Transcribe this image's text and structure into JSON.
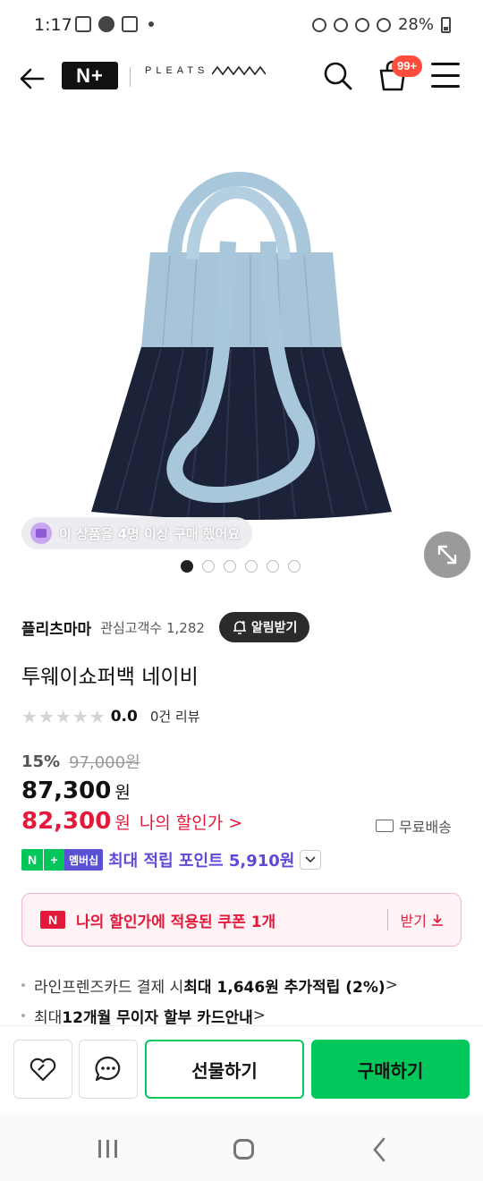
{
  "status_bar": {
    "time": "1:17",
    "battery": "28%"
  },
  "header": {
    "back_icon": "arrow-left-icon",
    "platform_logo": "N+",
    "brand_logo": "PLEATS",
    "search_icon": "search-icon",
    "cart_icon": "shopping-bag-icon",
    "cart_badge": "99+",
    "menu_icon": "hamburger-menu-icon"
  },
  "gallery": {
    "viewers_notice": "이 상품을 4명 이상 구매 했어요",
    "dot_count": 6,
    "active_dot": 0,
    "bag_colors": {
      "top": "#a7c4d8",
      "bottom": "#1c2338",
      "strap": "#a9c7db"
    }
  },
  "store": {
    "name": "플리츠마마",
    "fans": "관심고객수 1,282",
    "alarm_button": "알림받기"
  },
  "product": {
    "title": "투웨이쇼퍼백 네이비",
    "rating": "0.0",
    "rating_stars": 0,
    "review_count": "0건 리뷰"
  },
  "pricing": {
    "discount_rate": "15%",
    "original_price": "97,000원",
    "price": "87,300",
    "price_unit": "원",
    "my_price": "82,300",
    "my_price_unit": "원",
    "my_price_label": "나의 할인가",
    "my_price_chevron": ">",
    "shipping": "무료배송"
  },
  "membership": {
    "badge_n": "N",
    "badge_plus": "+",
    "badge_text": "멤버십",
    "points": "최대 적립 포인트 5,910원"
  },
  "coupon": {
    "logo": "N",
    "text": "나의 할인가에 적용된 쿠폰 1개",
    "download": "받기"
  },
  "benefits": {
    "card": {
      "prefix": "라인프렌즈카드 결제 시 ",
      "bold": "최대 1,646원 추가적립 (2%)",
      "suffix": " >"
    },
    "installment": {
      "prefix": "최대 ",
      "bold": "12개월 무이자 할부 카드안내",
      "suffix": " >"
    }
  },
  "actions": {
    "zzim_icon": "heart-icon",
    "talk_icon": "chat-bubble-icon",
    "gift": "선물하기",
    "buy": "구매하기"
  },
  "accent_colors": {
    "naver_green": "#03c75a",
    "discount_red": "#e3193b",
    "membership_purple": "#6248d8"
  }
}
